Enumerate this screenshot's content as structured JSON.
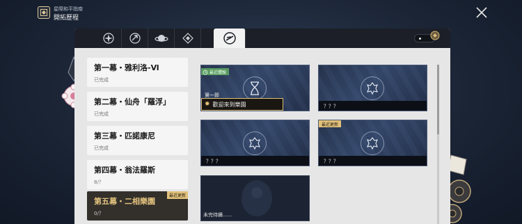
{
  "header": {
    "subtitle": "星際和平指南",
    "title": "開拓歷程"
  },
  "tabs": [
    {
      "icon": "compass-icon"
    },
    {
      "icon": "shield-arrow-icon"
    },
    {
      "icon": "planet-icon"
    },
    {
      "icon": "crest-icon"
    },
    {
      "icon": "trail-icon",
      "active": true
    }
  ],
  "chapters": [
    {
      "title": "第一幕・雅利洛-Ⅵ",
      "status": "已完成"
    },
    {
      "title": "第二幕・仙舟「羅浮」",
      "status": "已完成"
    },
    {
      "title": "第三幕・匹諾康尼",
      "status": "已完成"
    },
    {
      "title": "第四幕・翁法羅斯",
      "status": "8/？"
    },
    {
      "title": "第五幕・二相樂園",
      "status": "0/？",
      "badge": "最近更新",
      "selected": true
    }
  ],
  "episodes": [
    {
      "badge": "最近體驗",
      "label": "第一節",
      "title": "歡迎來到樂園",
      "icon": "hourglass-icon"
    },
    {
      "title": "？？？",
      "icon": "mask-icon"
    },
    {
      "title": "？？？",
      "icon": "mask-icon"
    },
    {
      "badge": "最近更新",
      "title": "？？？",
      "icon": "mask-icon"
    },
    {
      "title": "未完待續……"
    }
  ],
  "colors": {
    "accent_gold": "#e1c17a",
    "recent_green": "#5a9a62",
    "tab_bar": "#1c1f27"
  }
}
